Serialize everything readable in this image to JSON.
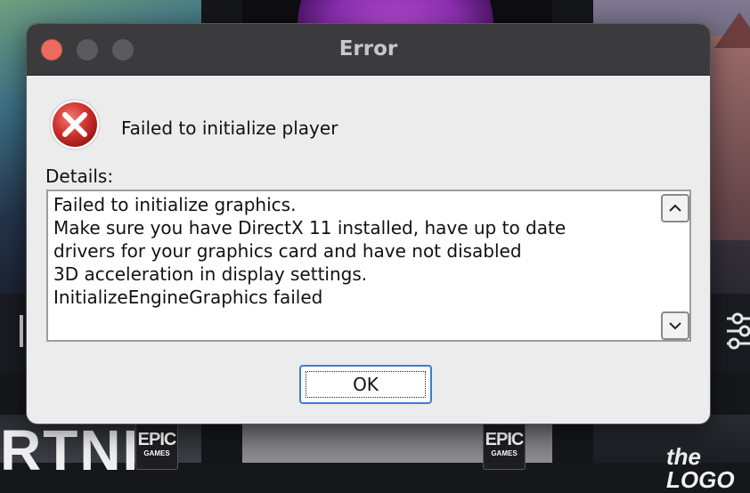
{
  "dialog": {
    "title": "Error",
    "message": "Failed to initialize player",
    "details_label": "Details:",
    "details_text": "Failed to initialize graphics.\nMake sure you have DirectX 11 installed, have up to date\ndrivers for your graphics card and have not disabled\n3D acceleration in display settings.\nInitializeEngineGraphics failed",
    "ok_label": "OK",
    "icon": "error-x-icon"
  },
  "background": {
    "tile_text_left": "RTNIT",
    "tile_text_right": "the LOGO",
    "epic_badges": [
      {
        "line1": "EPIC",
        "line2": "GAMES"
      },
      {
        "line1": "EPIC",
        "line2": "GAMES"
      }
    ]
  },
  "colors": {
    "titlebar": "#3b3b3d",
    "close_light": "#ed6a5e",
    "dialog_bg": "#ececec",
    "error_red": "#d0312d",
    "ok_border": "#3d7bd6"
  }
}
